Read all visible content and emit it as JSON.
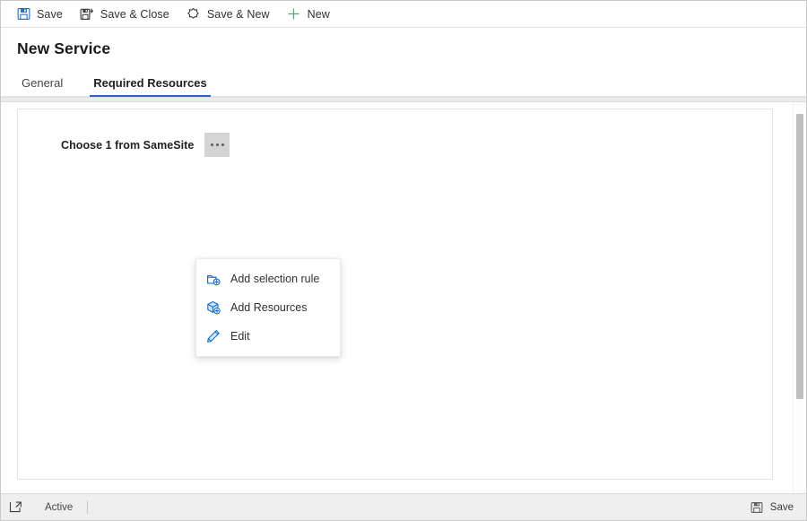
{
  "command_bar": {
    "buttons": [
      {
        "label": "Save",
        "icon": "save-floppy-icon"
      },
      {
        "label": "Save & Close",
        "icon": "save-and-close-icon"
      },
      {
        "label": "Save & New",
        "icon": "save-and-new-icon"
      },
      {
        "label": "New",
        "icon": "plus-icon"
      }
    ]
  },
  "header": {
    "title": "New Service",
    "tabs": [
      {
        "label": "General",
        "active": false
      },
      {
        "label": "Required Resources",
        "active": true
      }
    ]
  },
  "main": {
    "requirement_label": "Choose 1 from SameSite",
    "overflow_button_name": "ellipsis"
  },
  "context_menu": {
    "items": [
      {
        "label": "Add selection rule",
        "icon": "add-selection-rule-icon"
      },
      {
        "label": "Add Resources",
        "icon": "add-resources-box-icon"
      },
      {
        "label": "Edit",
        "icon": "pencil-edit-icon"
      }
    ]
  },
  "status_bar": {
    "expand_icon": "expand-popout-icon",
    "state": "Active",
    "save_label": "Save",
    "save_icon": "save-floppy-icon"
  },
  "colors": {
    "accent_blue": "#2b66c2",
    "icon_blue": "#0f6cbd",
    "new_green": "#4caf6d",
    "text_primary": "#201f1e",
    "text_secondary": "#484644",
    "panel_border": "#e3e3e3",
    "overflow_button_bg": "#d4d4d4",
    "status_bar_bg": "#efefef"
  }
}
